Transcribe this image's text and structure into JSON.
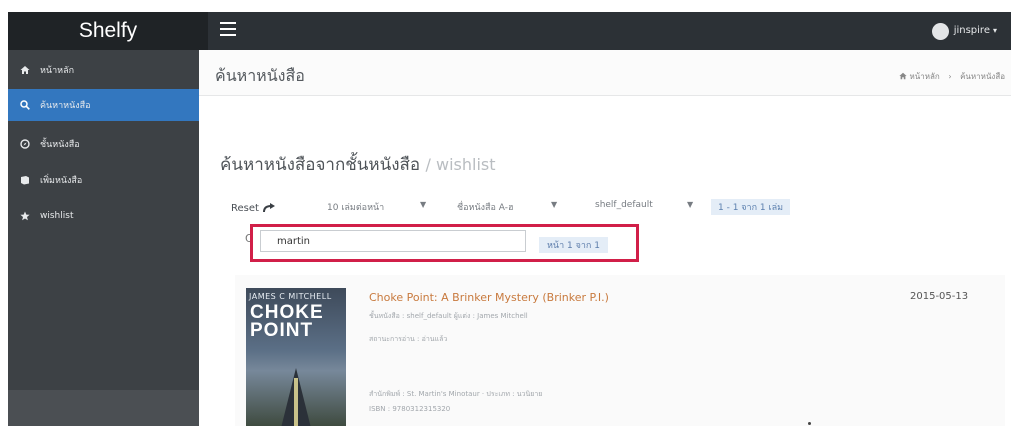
{
  "topbar": {
    "brand": "Shelfy",
    "user_name": "jinspire",
    "user_caret": "▾"
  },
  "sidebar": {
    "items": [
      {
        "label": "หน้าหลัก",
        "icon": "home-icon"
      },
      {
        "label": "ค้นหาหนังสือ",
        "icon": "search-icon",
        "active": true
      },
      {
        "label": "ชั้นหนังสือ",
        "icon": "compass-icon"
      },
      {
        "label": "เพิ่มหนังสือ",
        "icon": "book-icon"
      },
      {
        "label": "wishlist",
        "icon": "star-icon"
      }
    ]
  },
  "header": {
    "title": "ค้นหาหนังสือ",
    "breadcrumb": [
      "หน้าหลัก",
      "ค้นหาหนังสือ"
    ]
  },
  "section": {
    "title": "ค้นหาหนังสือจากชั้นหนังสือ",
    "shelf": "/ wishlist"
  },
  "toolbar": {
    "reset_label": "Reset",
    "per_page": "10 เล่มต่อหน้า",
    "sort": "ชื่อหนังสือ A-ฮ",
    "shelf": "shelf_default",
    "arrow": "▼",
    "count": "1 - 1 จาก 1 เล่ม"
  },
  "search": {
    "label": "Q",
    "value": "martin",
    "page": "หน้า 1 จาก 1"
  },
  "results": [
    {
      "cover_author": "JAMES C MITCHELL",
      "cover_title_1": "CHOKE",
      "cover_title_2": "POINT",
      "title": "Choke Point: A Brinker Mystery (Brinker P.I.)",
      "meta_1": "ชั้นหนังสือ : shelf_default ผู้แต่ง : James Mitchell",
      "meta_2": "สถานะการอ่าน : อ่านแล้ว",
      "meta_3": "สำนักพิมพ์ : St. Martin's Minotaur · ประเภท : นวนิยาย",
      "meta_4": "ISBN : 9780312315320",
      "date": "2015-05-13"
    }
  ],
  "colors": {
    "topbar": "#2c3136",
    "sidebar": "#3d4145",
    "active": "#3377bf",
    "highlight_frame": "#d11f48",
    "book_title": "#c87a3e"
  }
}
